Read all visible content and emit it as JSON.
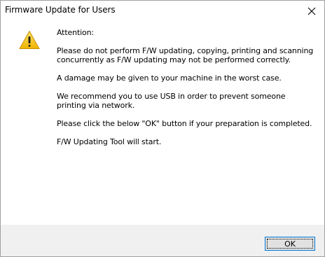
{
  "window": {
    "title": "Firmware Update for Users"
  },
  "icons": {
    "warning": "warning-icon",
    "close": "close-icon"
  },
  "message": {
    "heading": "Attention:",
    "paragraphs": [
      "Please do not perform F/W updating, copying, printing and scanning concurrently as F/W updating may not be performed correctly.",
      "A damage may be given to your machine in the worst case.",
      "We recommend you to use USB in order to prevent someone printing via network.",
      "Please click the below \"OK\" button if your preparation is completed.",
      "F/W Updating Tool will start."
    ]
  },
  "buttons": {
    "ok_label": "OK"
  },
  "colors": {
    "footer_bg": "#f0f0f0",
    "button_border_focus": "#0078d7",
    "warning_yellow": "#f5c518"
  }
}
